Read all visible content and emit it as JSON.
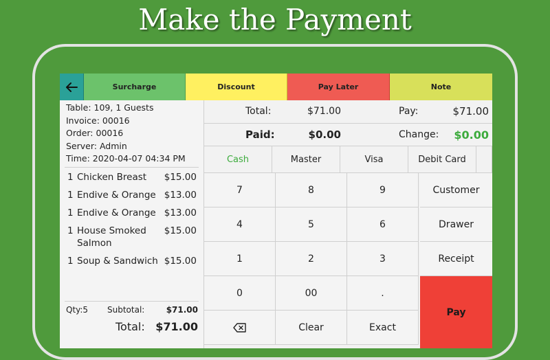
{
  "headline": "Make the Payment",
  "topbar": {
    "surcharge": "Surcharge",
    "discount": "Discount",
    "pay_later": "Pay Later",
    "note": "Note"
  },
  "order_info": {
    "table": "Table: 109, 1 Guests",
    "invoice": "Invoice: 00016",
    "order": "Order: 00016",
    "server": "Server: Admin",
    "time": "Time: 2020-04-07 04:34 PM"
  },
  "items": [
    {
      "qty": "1",
      "name": "Chicken Breast",
      "price": "$15.00"
    },
    {
      "qty": "1",
      "name": "Endive & Orange",
      "price": "$13.00"
    },
    {
      "qty": "1",
      "name": "Endive & Orange",
      "price": "$13.00"
    },
    {
      "qty": "1",
      "name": "House Smoked Salmon",
      "price": "$15.00"
    },
    {
      "qty": "1",
      "name": "Soup & Sandwich",
      "price": "$15.00"
    }
  ],
  "summary": {
    "qty": "Qty:5",
    "subtotal_label": "Subtotal:",
    "subtotal_value": "$71.00",
    "total_label": "Total:",
    "total_value": "$71.00"
  },
  "payment": {
    "total_label": "Total:",
    "total_value": "$71.00",
    "pay_label": "Pay:",
    "pay_value": "$71.00",
    "paid_label": "Paid:",
    "paid_value": "$0.00",
    "change_label": "Change:",
    "change_value": "$0.00"
  },
  "methods": [
    "Cash",
    "Master",
    "Visa",
    "Debit Card"
  ],
  "keypad": {
    "k7": "7",
    "k8": "8",
    "k9": "9",
    "k4": "4",
    "k5": "5",
    "k6": "6",
    "k1": "1",
    "k2": "2",
    "k3": "3",
    "k0": "0",
    "k00": "00",
    "dot": ".",
    "clear": "Clear",
    "exact": "Exact",
    "customer": "Customer",
    "drawer": "Drawer",
    "receipt": "Receipt",
    "pay": "Pay"
  },
  "colors": {
    "background": "#4f9a3c",
    "surcharge": "#6cc26b",
    "discount": "#fff060",
    "pay_later": "#ef5b53",
    "note": "#d8e05a",
    "back": "#2aa198",
    "pay_button": "#ef4037",
    "accent_green": "#3cab3c"
  },
  "icons": {
    "back": "arrow-left-icon",
    "backspace": "backspace-icon"
  }
}
